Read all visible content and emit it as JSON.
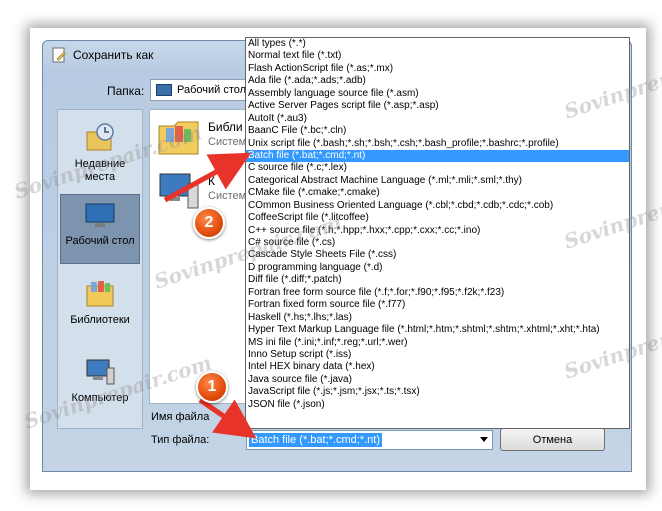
{
  "dialog": {
    "title": "Сохранить как",
    "folder_label": "Папка:",
    "folder_value": "Рабочий стол",
    "file_name_label": "Имя файла",
    "file_type_label": "Тип файла:",
    "file_type_value": "Batch file (*.bat;*.cmd;*.nt)",
    "cancel_label": "Отмена"
  },
  "places": [
    {
      "label": "Недавние места",
      "icon": "recent-places-icon"
    },
    {
      "label": "Рабочий стол",
      "icon": "desktop-icon",
      "selected": true
    },
    {
      "label": "Библиотеки",
      "icon": "libraries-icon"
    },
    {
      "label": "Компьютер",
      "icon": "computer-icon"
    }
  ],
  "file_items": [
    {
      "name": "Библи",
      "sub": "Систем"
    },
    {
      "name": "К",
      "sub": "Систем"
    }
  ],
  "file_types": [
    "All types (*.*)",
    "Normal text file (*.txt)",
    "Flash ActionScript file (*.as;*.mx)",
    "Ada file (*.ada;*.ads;*.adb)",
    "Assembly language source file (*.asm)",
    "Active Server Pages script file (*.asp;*.asp)",
    "AutoIt (*.au3)",
    "BaanC File (*.bc;*.cln)",
    "Unix script file (*.bash;*.sh;*.bsh;*.csh;*.bash_profile;*.bashrc;*.profile)",
    "Batch file (*.bat;*.cmd;*.nt)",
    "C source file (*.c;*.lex)",
    "Categorical Abstract Machine Language (*.ml;*.mli;*.sml;*.thy)",
    "CMake file (*.cmake;*.cmake)",
    "COmmon Business Oriented Language (*.cbl;*.cbd;*.cdb;*.cdc;*.cob)",
    "CoffeeScript file (*.litcoffee)",
    "C++ source file (*.h;*.hpp;*.hxx;*.cpp;*.cxx;*.cc;*.ino)",
    "C# source file (*.cs)",
    "Cascade Style Sheets File (*.css)",
    "D programming language (*.d)",
    "Diff file (*.diff;*.patch)",
    "Fortran free form source file (*.f;*.for;*.f90;*.f95;*.f2k;*.f23)",
    "Fortran fixed form source file (*.f77)",
    "Haskell (*.hs;*.lhs;*.las)",
    "Hyper Text Markup Language file (*.html;*.htm;*.shtml;*.shtm;*.xhtml;*.xht;*.hta)",
    "MS ini file (*.ini;*.inf;*.reg;*.url;*.wer)",
    "Inno Setup script (*.iss)",
    "Intel HEX binary data (*.hex)",
    "Java source file (*.java)",
    "JavaScript file (*.js;*.jsm;*.jsx;*.ts;*.tsx)",
    "JSON file (*.json)"
  ],
  "selected_type_index": 9,
  "annotations": {
    "badge_1": "1",
    "badge_2": "2",
    "watermark": "Sovinprepair.com"
  },
  "colors": {
    "selection": "#3399ff",
    "badge": "#e14c0e",
    "arrow": "#e8332a"
  }
}
